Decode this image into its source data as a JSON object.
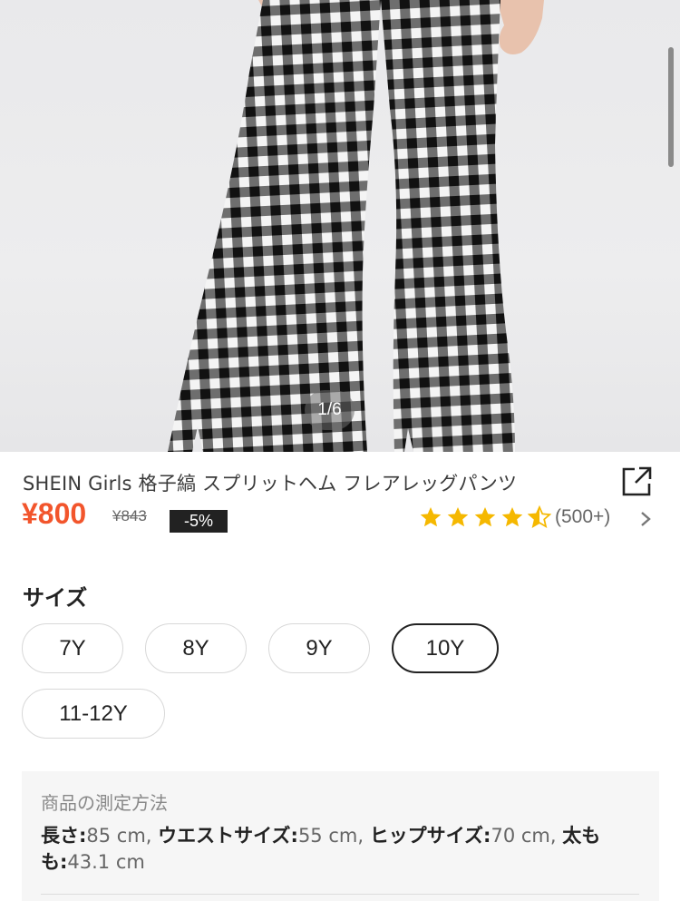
{
  "gallery": {
    "counter": "1/6"
  },
  "product": {
    "title": "SHEIN Girls 格子縞 スプリットヘム フレアレッグパンツ",
    "price": "¥800",
    "old_price": "¥843",
    "discount": "-5%",
    "rating_count": "(500+)",
    "rating_value": 4.5,
    "star_color": "#f5b800",
    "price_color": "#f2552c"
  },
  "sizes": {
    "label": "サイズ",
    "options": [
      "7Y",
      "8Y",
      "9Y",
      "10Y",
      "11-12Y"
    ],
    "selected": "10Y"
  },
  "measurement": {
    "title": "商品の測定方法",
    "items": [
      {
        "key": "長さ:",
        "value": "85 cm, "
      },
      {
        "key": "ウエストサイズ:",
        "value": "55 cm, "
      },
      {
        "key": "ヒップサイズ:",
        "value": "70 cm, "
      },
      {
        "key": "太もも:",
        "value": "43.1 cm"
      }
    ]
  }
}
